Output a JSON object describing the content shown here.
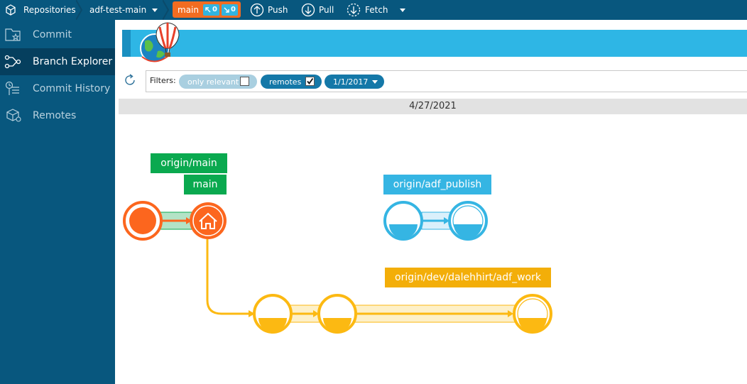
{
  "topbar": {
    "repositories_label": "Repositories",
    "repo_name": "adf-test-main",
    "branch_name": "main",
    "outgoing_count": "0",
    "incoming_count": "0",
    "push_label": "Push",
    "pull_label": "Pull",
    "fetch_label": "Fetch"
  },
  "sidebar": {
    "items": [
      {
        "label": "Commit",
        "icon": "commit-icon",
        "active": false
      },
      {
        "label": "Branch Explorer",
        "icon": "branch-explorer-icon",
        "active": true
      },
      {
        "label": "Commit History",
        "icon": "commit-history-icon",
        "active": false
      },
      {
        "label": "Remotes",
        "icon": "remotes-icon",
        "active": false
      }
    ]
  },
  "filters": {
    "label": "Filters:",
    "only_relevant": {
      "label": "only relevant",
      "checked": false
    },
    "remotes": {
      "label": "remotes",
      "checked": true
    },
    "since_date": "1/1/2017"
  },
  "timeline": {
    "date": "4/27/2021"
  },
  "graph": {
    "branch_labels": {
      "origin_main": "origin/main",
      "main": "main",
      "origin_adf_publish": "origin/adf_publish",
      "origin_dev_work": "origin/dev/dalehhirt/adf_work"
    },
    "colors": {
      "main": "#fc661e",
      "main_label": "#0aa94f",
      "publish": "#35b5e3",
      "dev": "#fcb912",
      "dev_label": "#f3ae09"
    }
  },
  "colors": {
    "topbar": "#08577e",
    "sidebar_active": "#053f5e",
    "banner": "#2eb6e5",
    "branch_pill": "#f26c21"
  }
}
